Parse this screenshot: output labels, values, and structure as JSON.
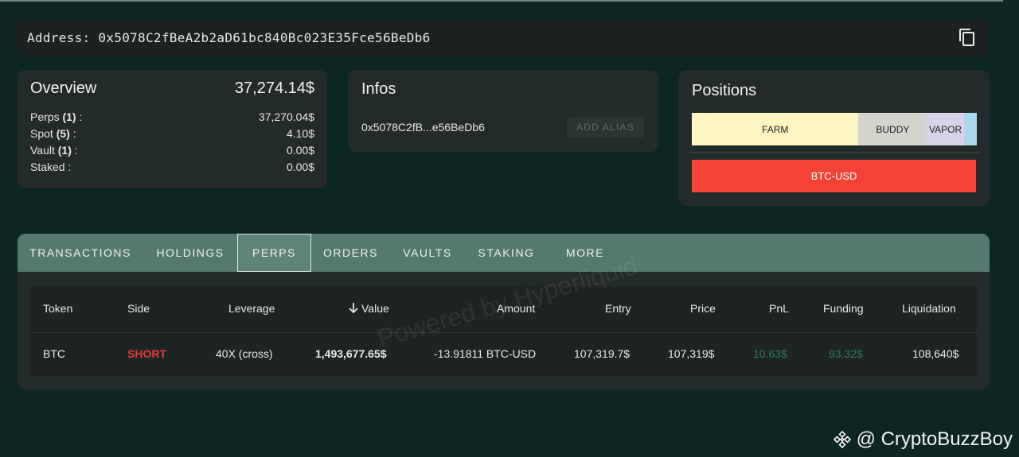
{
  "address_bar": {
    "text": "Address: 0x5078C2fBeA2b2aD61bc840Bc023E35Fce56BeDb6",
    "copy_icon": "content-copy-icon"
  },
  "overview": {
    "title": "Overview",
    "total": "37,274.14$",
    "rows": [
      {
        "label": "Perps",
        "count": "(1)",
        "suffix": " :",
        "value": "37,270.04$"
      },
      {
        "label": "Spot",
        "count": "(5)",
        "suffix": " :",
        "value": "4.10$"
      },
      {
        "label": "Vault",
        "count": "(1)",
        "suffix": " :",
        "value": "0.00$"
      },
      {
        "label": "Staked",
        "count": "",
        "suffix": " :",
        "value": "0.00$"
      }
    ]
  },
  "infos": {
    "title": "Infos",
    "address": "0x5078C2fB...e56BeDb6",
    "add_alias": "ADD ALIAS"
  },
  "positions": {
    "title": "Positions",
    "segments": [
      {
        "label": "FARM",
        "share": 0.585,
        "color": "#fdf6c3"
      },
      {
        "label": "BUDDY",
        "share": 0.24,
        "color": "#d4d4cc"
      },
      {
        "label": "VAPOR",
        "share": 0.13,
        "color": "#d8d3ea"
      },
      {
        "label": "",
        "share": 0.045,
        "color": "#a8d8ea"
      }
    ],
    "perp_bar": {
      "label": "BTC-USD",
      "color": "#f44336"
    }
  },
  "tabs": [
    "TRANSACTIONS",
    "HOLDINGS",
    "PERPS",
    "ORDERS",
    "VAULTS",
    "STAKING",
    "MORE"
  ],
  "active_tab": "PERPS",
  "table": {
    "headers": {
      "token": "Token",
      "side": "Side",
      "leverage": "Leverage",
      "value": "Value",
      "amount": "Amount",
      "entry": "Entry",
      "price": "Price",
      "pnl": "PnL",
      "funding": "Funding",
      "liquidation": "Liquidation"
    },
    "row": {
      "token": "BTC",
      "side": "SHORT",
      "leverage": "40X (cross)",
      "value": "1,493,677.65$",
      "amount": "-13.91811 BTC-USD",
      "entry": "107,319.7$",
      "price": "107,319$",
      "pnl": "10.63$",
      "funding": "93.32$",
      "liquidation": "108,640$"
    },
    "colors": {
      "short": "#e53935",
      "positive": "#2e7d5b"
    },
    "watermark": "Powered by Hyperliquid"
  },
  "credit": {
    "text": "@ CryptoBuzzBoy",
    "icon": "binance-logo-icon"
  }
}
